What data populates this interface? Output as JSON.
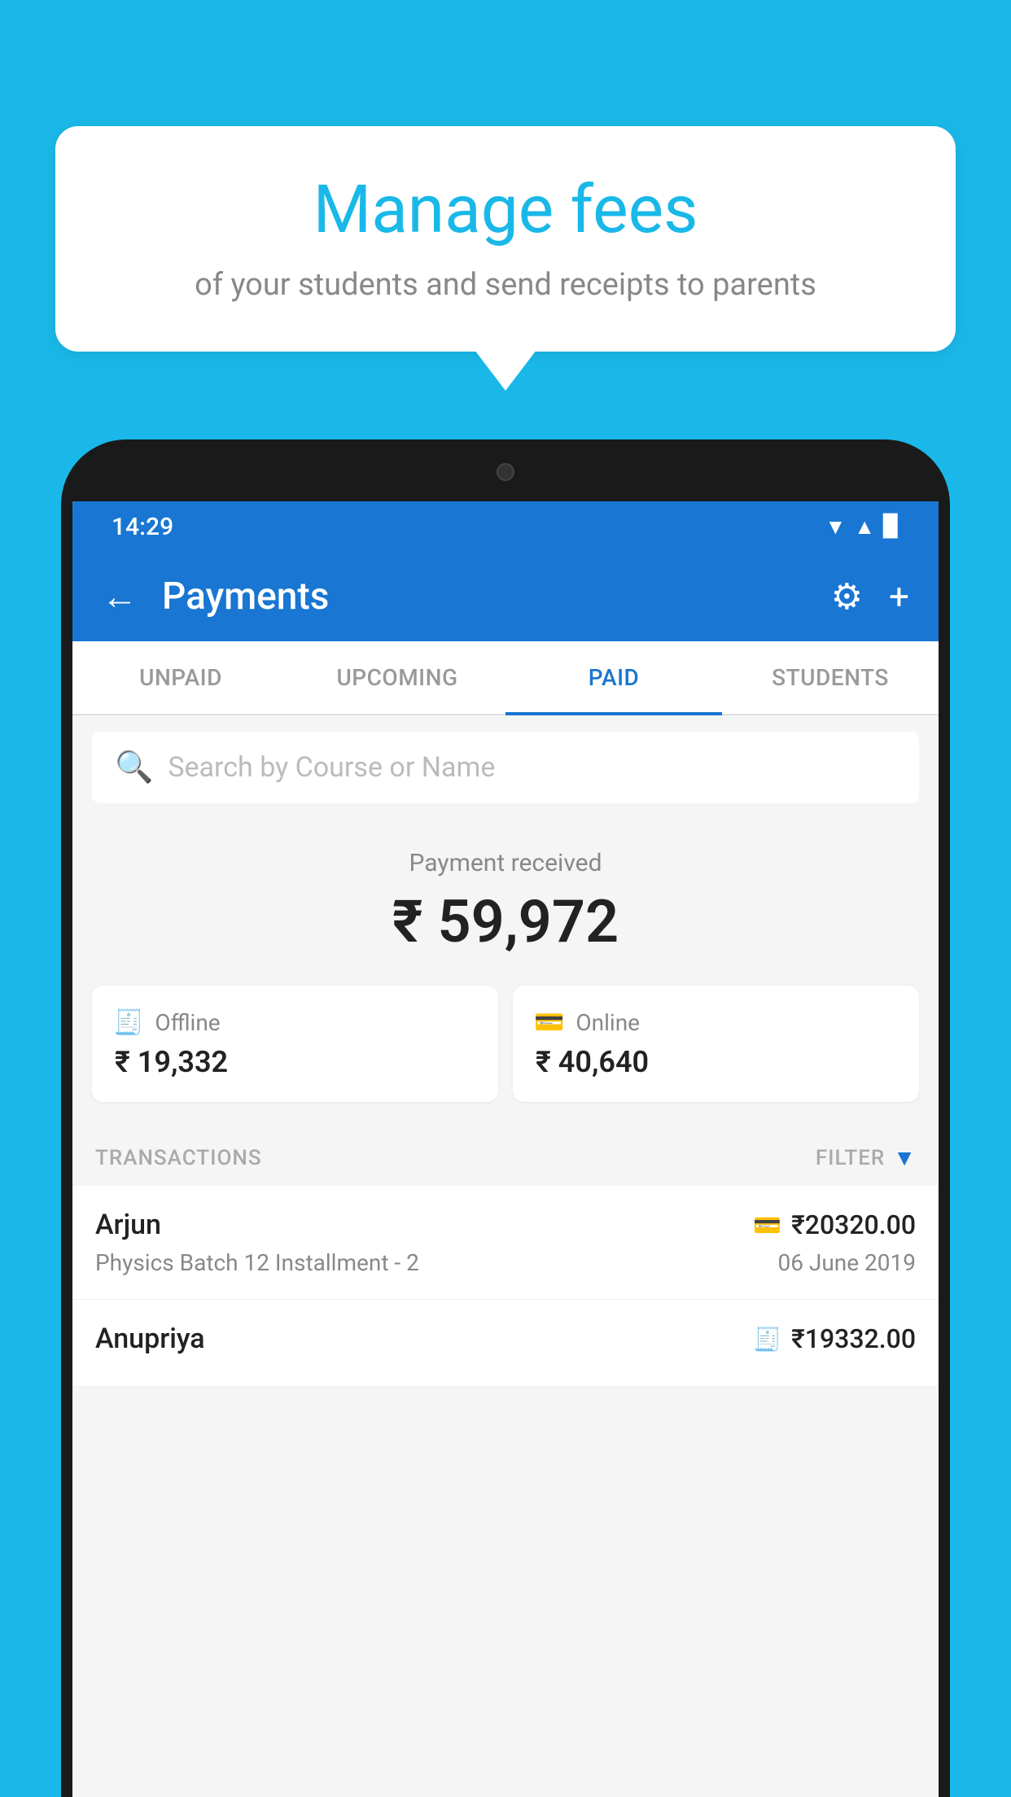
{
  "background_color": "#1ab8e8",
  "bubble": {
    "title": "Manage fees",
    "subtitle": "of your students and send receipts to parents"
  },
  "status_bar": {
    "time": "14:29",
    "icons": [
      "wifi",
      "signal",
      "battery"
    ]
  },
  "app_bar": {
    "title": "Payments",
    "back_label": "←",
    "gear_label": "⚙",
    "plus_label": "+"
  },
  "tabs": [
    {
      "label": "UNPAID",
      "active": false
    },
    {
      "label": "UPCOMING",
      "active": false
    },
    {
      "label": "PAID",
      "active": true
    },
    {
      "label": "STUDENTS",
      "active": false
    }
  ],
  "search": {
    "placeholder": "Search by Course or Name"
  },
  "payment_summary": {
    "label": "Payment received",
    "total": "₹ 59,972",
    "offline": {
      "label": "Offline",
      "amount": "₹ 19,332"
    },
    "online": {
      "label": "Online",
      "amount": "₹ 40,640"
    }
  },
  "transactions": {
    "header": "TRANSACTIONS",
    "filter_label": "FILTER",
    "rows": [
      {
        "name": "Arjun",
        "course": "Physics Batch 12 Installment - 2",
        "amount": "₹20320.00",
        "date": "06 June 2019",
        "payment_type": "online"
      },
      {
        "name": "Anupriya",
        "course": "",
        "amount": "₹19332.00",
        "date": "",
        "payment_type": "offline"
      }
    ]
  }
}
